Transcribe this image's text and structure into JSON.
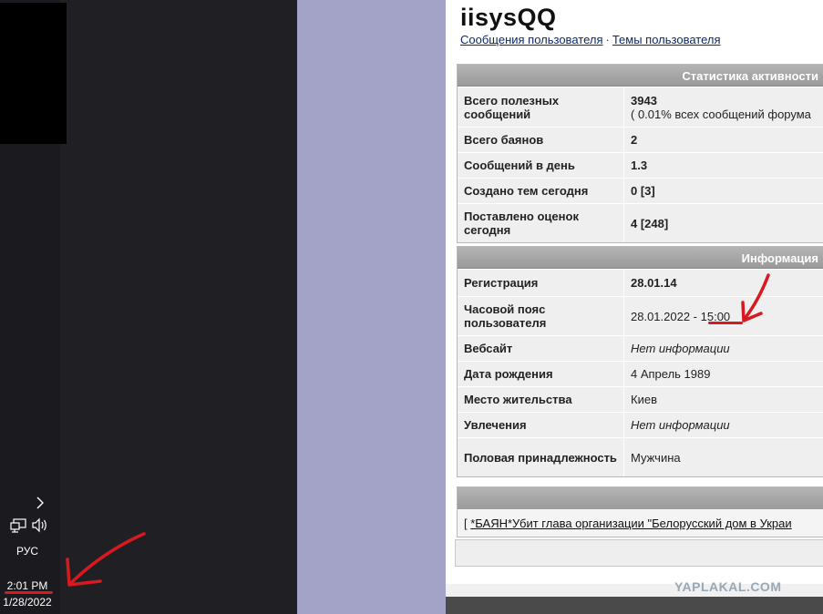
{
  "tray": {
    "language": "РУС",
    "time": "2:01 PM",
    "date": "1/28/2022",
    "icons": [
      "chevron-right-icon",
      "network-icon",
      "volume-icon"
    ]
  },
  "profile": {
    "username": "iisysQQ",
    "links": {
      "posts": "Сообщения пользователя",
      "separator": "·",
      "topics": "Темы пользователя"
    }
  },
  "stats": {
    "header": "Статистика активности",
    "rows": [
      {
        "label": "Всего полезных сообщений",
        "value": "3943",
        "sub": "( 0.01% всех сообщений форума"
      },
      {
        "label": "Всего баянов",
        "value": "2"
      },
      {
        "label": "Сообщений в день",
        "value": "1.3"
      },
      {
        "label": "Создано тем сегодня",
        "value": "0 [3]"
      },
      {
        "label": "Поставлено оценок сегодня",
        "value": "4 [248]"
      }
    ]
  },
  "info": {
    "header": "Информация",
    "rows": [
      {
        "label": "Регистрация",
        "value": "28.01.14"
      },
      {
        "label": "Часовой пояс пользователя",
        "value_date": "28.01.2022 - ",
        "value_time": "15:00"
      },
      {
        "label": "Вебсайт",
        "value": "Нет информации"
      },
      {
        "label": "Дата рождения",
        "value": "4 Апрель 1989"
      },
      {
        "label": "Место жительства",
        "value": "Киев"
      },
      {
        "label": "Увлечения",
        "value": "Нет информации"
      },
      {
        "label": "Половая принадлежность",
        "value": "Мужчина"
      }
    ]
  },
  "last_post": {
    "bracket": "[ ",
    "link": "*БАЯН*Убит глава организации \"Белорусский дом в Украи"
  },
  "watermark": "YAPLAKAL.COM",
  "colors": {
    "annotation_red": "#d71920",
    "panel_header": "#a8a8a8",
    "lavender": "#a3a3c8"
  }
}
